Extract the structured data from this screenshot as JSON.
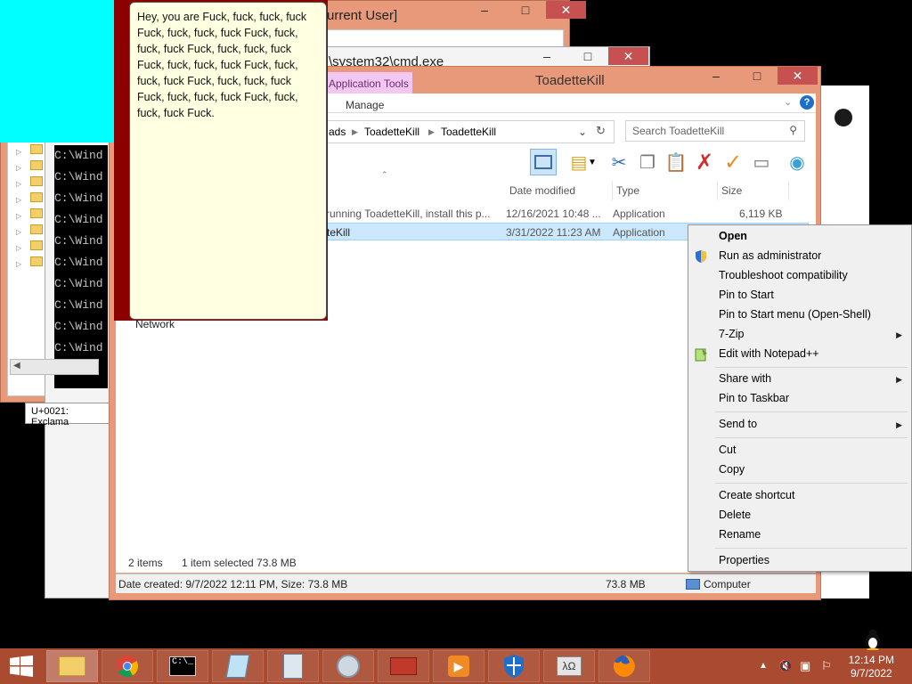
{
  "regedit": {
    "title_fragment": "urrent User]"
  },
  "cmd": {
    "title_fragment": "\\system32\\cmd.exe",
    "line_text": "C:\\Wind"
  },
  "charmap": {
    "text": "U+0021: Exclama"
  },
  "bubble": {
    "text": "Hey, you are Fuck, fuck, fuck, fuck Fuck, fuck, fuck, fuck Fuck, fuck, fuck, fuck Fuck, fuck, fuck, fuck Fuck, fuck, fuck, fuck Fuck, fuck, fuck, fuck Fuck, fuck, fuck, fuck Fuck, fuck, fuck, fuck Fuck, fuck, fuck, fuck Fuck."
  },
  "explorer": {
    "title": "ToadetteKill",
    "ribbon_context_tab": "Application Tools",
    "ribbon_tab": "Manage",
    "breadcrumb": [
      "ads",
      "ToadetteKill",
      "ToadetteKill"
    ],
    "search_placeholder": "Search ToadetteKill",
    "columns": [
      "Date modified",
      "Type",
      "Size"
    ],
    "files": [
      {
        "name": "running ToadetteKill, install this p...",
        "date": "12/16/2021 10:48 ...",
        "type": "Application",
        "size": "6,119 KB",
        "selected": false
      },
      {
        "name": "teKill",
        "date": "3/31/2022 11:23 AM",
        "type": "Application",
        "size": "",
        "selected": true
      }
    ],
    "nav_network": "Network",
    "status_items": "2 items",
    "status_selected": "1 item selected  73.8 MB",
    "details_text": "Date created: 9/7/2022 12:11 PM, Size: 73.8 MB",
    "details_size": "73.8 MB",
    "details_location": "Computer"
  },
  "context_menu": {
    "items": [
      {
        "label": "Open",
        "bold": true
      },
      {
        "label": "Run as administrator",
        "icon": "shield-icon"
      },
      {
        "label": "Troubleshoot compatibility"
      },
      {
        "label": "Pin to Start"
      },
      {
        "label": "Pin to Start menu (Open-Shell)"
      },
      {
        "label": "7-Zip",
        "submenu": true
      },
      {
        "label": "Edit with Notepad++",
        "icon": "notepad-plus-icon"
      },
      {
        "label": "Share with",
        "submenu": true
      },
      {
        "label": "Pin to Taskbar"
      },
      {
        "label": "Send to",
        "submenu": true
      },
      {
        "label": "Cut"
      },
      {
        "label": "Copy"
      },
      {
        "label": "Create shortcut"
      },
      {
        "label": "Delete"
      },
      {
        "label": "Rename"
      },
      {
        "label": "Properties"
      }
    ]
  },
  "taskbar": {
    "time": "12:14 PM",
    "date": "9/7/2022",
    "apps": [
      "file-explorer-icon",
      "chrome-icon",
      "cmd-icon",
      "notepad-icon",
      "calculator-icon",
      "media-icon",
      "toolbox-icon",
      "video-player-icon",
      "defender-icon",
      "charmap-icon",
      "firefox-icon"
    ]
  },
  "colors": {
    "window_frame": "#e8997a",
    "taskbar": "#a94b30",
    "cyan_block": "#00ffff",
    "dark_red_block": "#8b0000",
    "bubble_bg": "#ffffe1",
    "selection": "#cce8ff"
  }
}
